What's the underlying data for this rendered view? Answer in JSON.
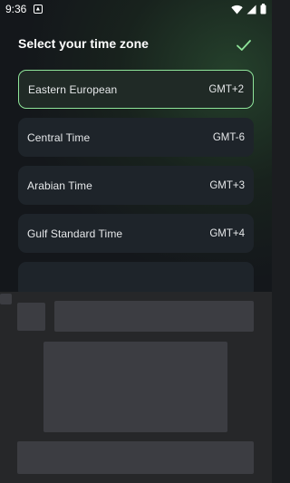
{
  "status_bar": {
    "time": "9:36"
  },
  "title": "Select your time zone",
  "confirm_icon": "check-icon",
  "timezones": [
    {
      "name": "Eastern European",
      "offset": "GMT+2",
      "selected": true
    },
    {
      "name": "Central Time",
      "offset": "GMT-6",
      "selected": false
    },
    {
      "name": "Arabian Time",
      "offset": "GMT+3",
      "selected": false
    },
    {
      "name": "Gulf Standard Time",
      "offset": "GMT+4",
      "selected": false
    }
  ],
  "colors": {
    "accent": "#8fe59a",
    "card": "#1e242a",
    "placeholder": "#3c3d42"
  }
}
